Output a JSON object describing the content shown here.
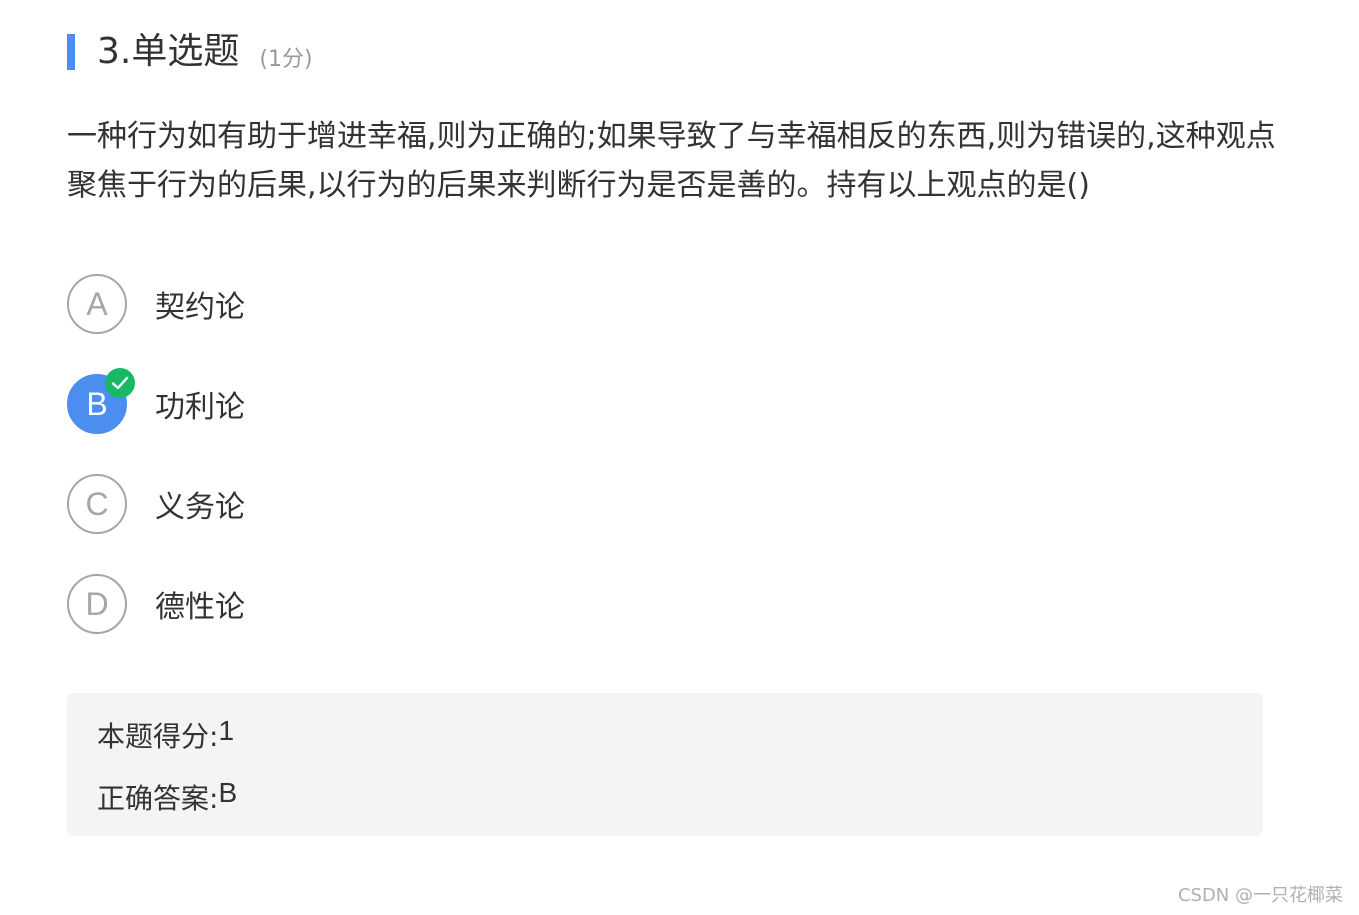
{
  "question": {
    "title": "3.单选题",
    "score_text": "(1分)",
    "stem": "一种行为如有助于增进幸福,则为正确的;如果导致了与幸福相反的东西,则为错误的,这种观点聚焦于行为的后果,以行为的后果来判断行为是否是善的。持有以上观点的是()",
    "options": [
      {
        "letter": "A",
        "text": "契约论",
        "selected": false
      },
      {
        "letter": "B",
        "text": "功利论",
        "selected": true,
        "icon": "check-icon"
      },
      {
        "letter": "C",
        "text": "义务论",
        "selected": false
      },
      {
        "letter": "D",
        "text": "德性论",
        "selected": false
      }
    ]
  },
  "result": {
    "score_label": "本题得分:",
    "score_value": "1",
    "answer_label": "正确答案:",
    "answer_value": "B"
  },
  "watermark": "CSDN @一只花椰菜",
  "colors": {
    "accent": "#4b8ef0",
    "correct": "#19b865",
    "result_bg": "#f4f4f4"
  }
}
